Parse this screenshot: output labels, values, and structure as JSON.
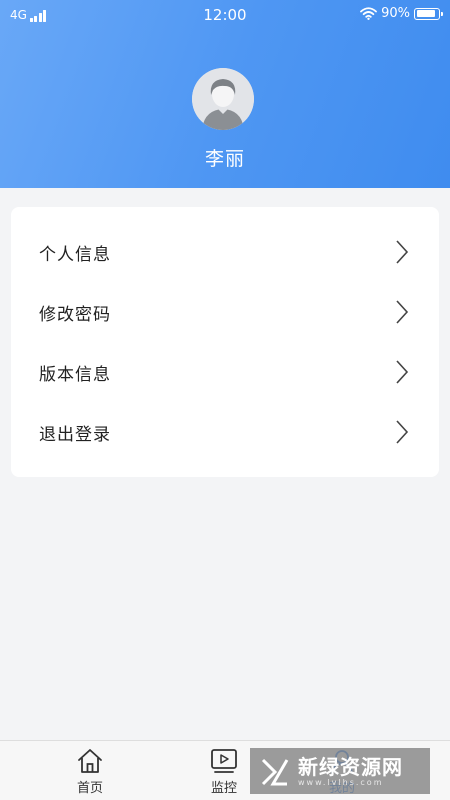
{
  "status_bar": {
    "network": "4G",
    "time": "12:00",
    "battery_percent": "90%",
    "battery_level": 0.9,
    "icons": [
      "signal-icon",
      "wifi-icon",
      "battery-icon"
    ]
  },
  "profile": {
    "username": "李丽",
    "avatar_icon": "default-avatar-icon"
  },
  "menu": {
    "items": [
      {
        "label": "个人信息",
        "icon": "chevron-right-icon"
      },
      {
        "label": "修改密码",
        "icon": "chevron-right-icon"
      },
      {
        "label": "版本信息",
        "icon": "chevron-right-icon"
      },
      {
        "label": "退出登录",
        "icon": "chevron-right-icon"
      }
    ]
  },
  "tabbar": {
    "tabs": [
      {
        "label": "首页",
        "icon": "home-icon"
      },
      {
        "label": "监控",
        "icon": "video-play-icon"
      },
      {
        "label": "我的",
        "icon": "user-icon",
        "active": true
      }
    ]
  },
  "watermark": {
    "text": "新绿资源网",
    "subtext": "www.lvlhs.com"
  },
  "colors": {
    "header_gradient_start": "#69a8f7",
    "header_gradient_end": "#3f8cef",
    "active_tab": "#3d8af0",
    "page_background": "#f3f4f6"
  }
}
